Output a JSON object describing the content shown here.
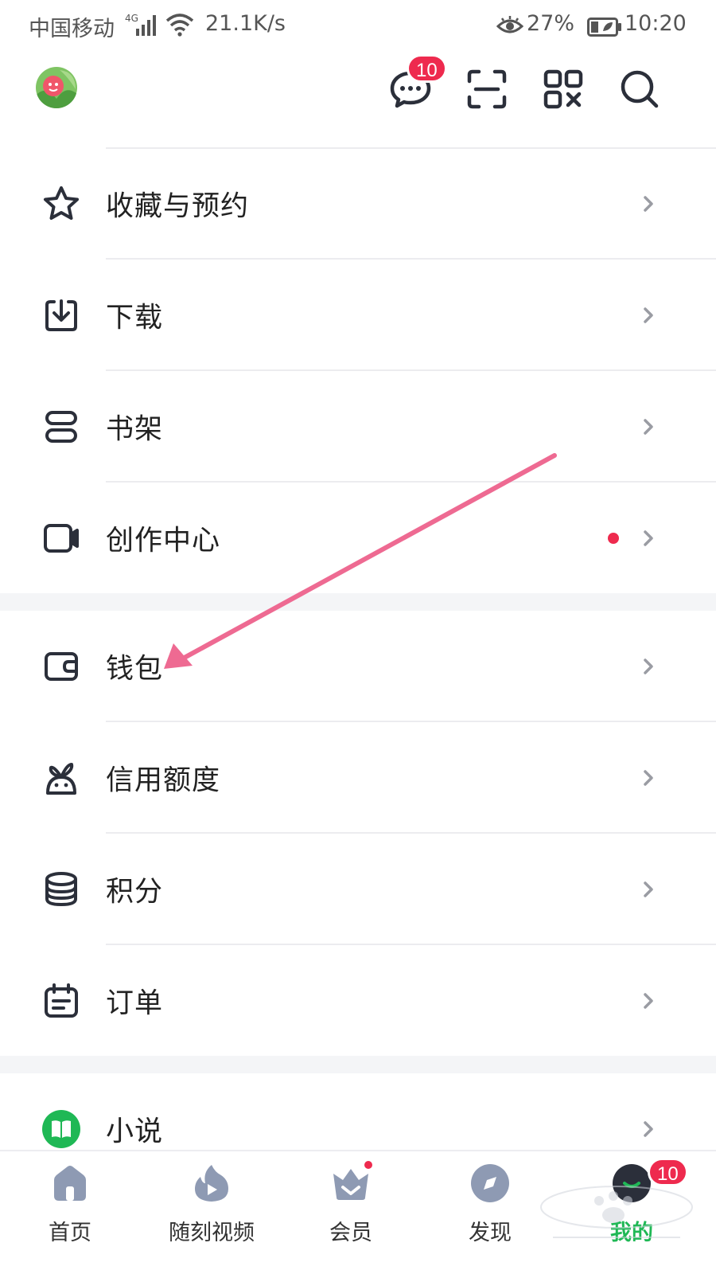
{
  "status_bar": {
    "carrier": "中国移动",
    "network": "4G",
    "speed": "21.1K/s",
    "battery_percent": "27%",
    "time": "10:20"
  },
  "header": {
    "message_badge": "10",
    "icons": [
      "chat-icon",
      "scan-icon",
      "qr-code-icon",
      "search-icon"
    ]
  },
  "menu": {
    "items": [
      {
        "label": "收藏与预约",
        "icon": "star-icon"
      },
      {
        "label": "下载",
        "icon": "download-icon"
      },
      {
        "label": "书架",
        "icon": "bookshelf-icon"
      },
      {
        "label": "创作中心",
        "icon": "video-camera-icon",
        "has_dot": true
      },
      {
        "label": "钱包",
        "icon": "wallet-icon"
      },
      {
        "label": "信用额度",
        "icon": "credit-icon"
      },
      {
        "label": "积分",
        "icon": "coins-icon"
      },
      {
        "label": "订单",
        "icon": "order-icon"
      },
      {
        "label": "小说",
        "icon": "novel-book-icon"
      }
    ]
  },
  "bottom_nav": {
    "items": [
      {
        "label": "首页",
        "icon": "home-icon"
      },
      {
        "label": "随刻视频",
        "icon": "flame-play-icon"
      },
      {
        "label": "会员",
        "icon": "crown-icon"
      },
      {
        "label": "发现",
        "icon": "compass-icon"
      },
      {
        "label": "我的",
        "icon": "profile-avatar-icon",
        "active": true
      }
    ],
    "profile_badge": "10"
  },
  "colors": {
    "accent_green": "#1fb855",
    "badge_red": "#ee2a4e",
    "icon_dark": "#2b2f3a",
    "nav_icon_gray": "#8e9ab3",
    "annotation_arrow": "#ee6a92"
  }
}
